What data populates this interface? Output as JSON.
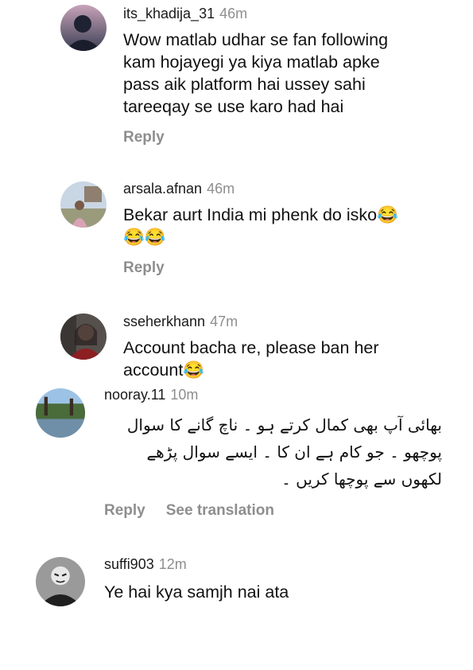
{
  "comments": [
    {
      "username": "its_khadija_31",
      "time": "46m",
      "text": "Wow matlab udhar se fan following\nkam hojayegi ya kiya matlab apke\npass aik platform hai ussey sahi\ntareeqay se use karo had hai",
      "reply": "Reply",
      "avatar_icon": "dark-portrait-avatar"
    },
    {
      "username": "arsala.afnan",
      "time": "46m",
      "text": "Bekar aurt India mi phenk do isko😂\n😂😂",
      "reply": "Reply",
      "avatar_icon": "outdoor-person-avatar"
    },
    {
      "username": "sseherkhann",
      "time": "47m",
      "text": "Account bacha re, please ban her\naccount😂",
      "reply": "",
      "avatar_icon": "selfie-avatar"
    },
    {
      "username": "nooray.11",
      "time": "10m",
      "text": "بھائی آپ بھی کمال کرتے ہو ۔ ناچ گانے کا سوال\nپوچھو ۔ جو کام ہے ان کا ۔ ایسے سوال پڑھے\nلکھوں سے پوچھا کریں ۔",
      "reply": "Reply",
      "see_translation": "See translation",
      "avatar_icon": "landscape-avatar"
    },
    {
      "username": "suffi903",
      "time": "12m",
      "text": "Ye hai kya samjh nai ata",
      "reply": "",
      "avatar_icon": "masked-person-avatar"
    }
  ]
}
